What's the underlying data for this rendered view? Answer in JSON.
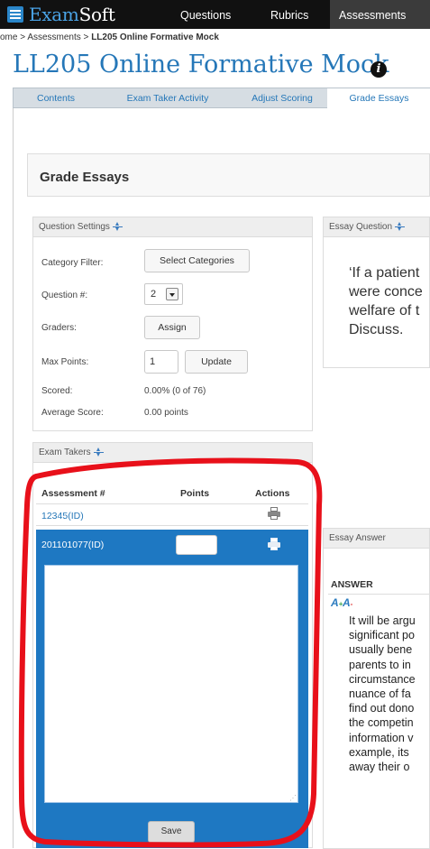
{
  "brand": {
    "name_a": "Exam",
    "name_b": "Soft"
  },
  "nav": {
    "questions": "Questions",
    "rubrics": "Rubrics",
    "assessments": "Assessments"
  },
  "breadcrumb": {
    "home": "ome",
    "sep1": " > ",
    "assessments": "Assessments",
    "sep2": " > ",
    "current": "LL205 Online Formative Mock"
  },
  "page_title": "LL205 Online Formative Mock",
  "tabs": [
    "Contents",
    "Exam Taker Activity",
    "Adjust Scoring",
    "Grade Essays"
  ],
  "section_title": "Grade Essays",
  "question_settings": {
    "title": "Question Settings",
    "category_filter_label": "Category Filter:",
    "select_categories_button": "Select Categories",
    "question_num_label": "Question #:",
    "question_num_value": "2",
    "graders_label": "Graders:",
    "assign_button": "Assign",
    "max_points_label": "Max Points:",
    "max_points_value": "1",
    "update_button": "Update",
    "scored_label": "Scored:",
    "scored_value": "0.00% (0 of 76)",
    "average_label": "Average Score:",
    "average_value": "0.00 points"
  },
  "essay_question": {
    "title": "Essay Question",
    "lines": [
      "‘If a patient",
      "were conce",
      "welfare of t",
      "Discuss."
    ]
  },
  "exam_takers": {
    "title": "Exam Takers",
    "col_assessment": "Assessment #",
    "col_points": "Points",
    "col_actions": "Actions",
    "rows": [
      {
        "id": "12345(ID)"
      },
      {
        "id": "201101077(ID)"
      }
    ],
    "submit_label": "Save"
  },
  "essay_answer": {
    "title": "Essay Answer",
    "answer_label": "ANSWER",
    "lines": [
      "It will be argu",
      "significant po",
      "usually bene",
      "parents to in",
      "circumstance",
      "nuance of fa",
      "find out dono",
      "the competin",
      "information v",
      "example, its",
      "away their o"
    ]
  },
  "colors": {
    "nav_bg": "#111111",
    "brand_blue": "#2577b8",
    "selected_row": "#1e78c2",
    "annotation": "#e8101a"
  }
}
